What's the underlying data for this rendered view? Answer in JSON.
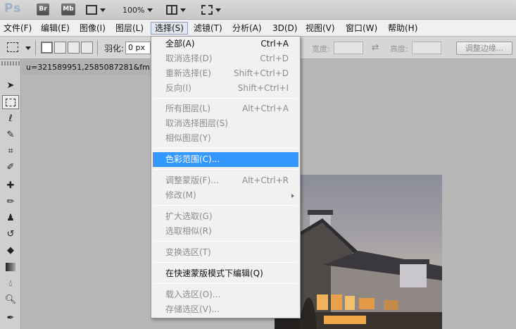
{
  "appbar": {
    "logo": "Ps",
    "bridge_label": "Br",
    "minibridge_label": "Mb",
    "zoom": "100%"
  },
  "menubar": [
    {
      "label": "文件(F)"
    },
    {
      "label": "编辑(E)"
    },
    {
      "label": "图像(I)"
    },
    {
      "label": "图层(L)"
    },
    {
      "label": "选择(S)",
      "active": true
    },
    {
      "label": "滤镜(T)"
    },
    {
      "label": "分析(A)"
    },
    {
      "label": "3D(D)"
    },
    {
      "label": "视图(V)"
    },
    {
      "label": "窗口(W)"
    },
    {
      "label": "帮助(H)"
    }
  ],
  "options": {
    "feather_label": "羽化:",
    "feather_value": "0 px",
    "width_label": "宽度:",
    "height_label": "高度:",
    "refine_edge_label": "调整边缘..."
  },
  "document": {
    "tab_title": "u=321589951,2585087281&fm"
  },
  "select_menu": {
    "items": [
      {
        "label": "全部(A)",
        "shortcut": "Ctrl+A",
        "enabled": true
      },
      {
        "label": "取消选择(D)",
        "shortcut": "Ctrl+D",
        "enabled": false
      },
      {
        "label": "重新选择(E)",
        "shortcut": "Shift+Ctrl+D",
        "enabled": false
      },
      {
        "label": "反向(I)",
        "shortcut": "Shift+Ctrl+I",
        "enabled": false
      },
      {
        "label": "所有图层(L)",
        "shortcut": "Alt+Ctrl+A",
        "enabled": false
      },
      {
        "label": "取消选择图层(S)",
        "shortcut": "",
        "enabled": false
      },
      {
        "label": "相似图层(Y)",
        "shortcut": "",
        "enabled": false
      },
      {
        "label": "色彩范围(C)...",
        "shortcut": "",
        "enabled": true,
        "highlighted": true
      },
      {
        "label": "调整蒙版(F)...",
        "shortcut": "Alt+Ctrl+R",
        "enabled": false
      },
      {
        "label": "修改(M)",
        "shortcut": "",
        "enabled": false,
        "submenu": true
      },
      {
        "label": "扩大选取(G)",
        "shortcut": "",
        "enabled": false
      },
      {
        "label": "选取相似(R)",
        "shortcut": "",
        "enabled": false
      },
      {
        "label": "变换选区(T)",
        "shortcut": "",
        "enabled": false
      },
      {
        "label": "在快速蒙版模式下编辑(Q)",
        "shortcut": "",
        "enabled": true
      },
      {
        "label": "载入选区(O)...",
        "shortcut": "",
        "enabled": false
      },
      {
        "label": "存储选区(V)...",
        "shortcut": "",
        "enabled": false
      }
    ],
    "highlight_color": "#3399ff"
  },
  "tools": [
    {
      "name": "move-tool-icon"
    },
    {
      "name": "rectangular-marquee-tool-icon",
      "active": true
    },
    {
      "name": "lasso-tool-icon"
    },
    {
      "name": "quick-selection-tool-icon"
    },
    {
      "name": "crop-tool-icon"
    },
    {
      "name": "eyedropper-tool-icon"
    },
    {
      "name": "healing-brush-tool-icon"
    },
    {
      "name": "brush-tool-icon"
    },
    {
      "name": "clone-stamp-tool-icon"
    },
    {
      "name": "history-brush-tool-icon"
    },
    {
      "name": "eraser-tool-icon"
    },
    {
      "name": "gradient-tool-icon"
    },
    {
      "name": "blur-tool-icon"
    },
    {
      "name": "dodge-tool-icon"
    },
    {
      "name": "pen-tool-icon"
    }
  ]
}
